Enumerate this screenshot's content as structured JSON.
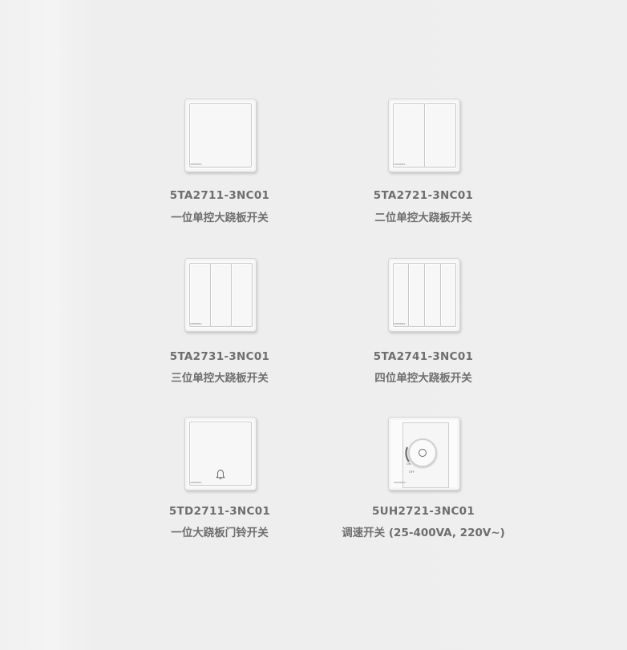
{
  "products": [
    {
      "code": "5TA2711-3NC01",
      "name": "一位单控大跷板开关",
      "brand": "SIEMENS"
    },
    {
      "code": "5TA2721-3NC01",
      "name": "二位单控大跷板开关",
      "brand": "SIEMENS"
    },
    {
      "code": "5TA2731-3NC01",
      "name": "三位单控大跷板开关",
      "brand": "SIEMENS"
    },
    {
      "code": "5TA2741-3NC01",
      "name": "四位单控大跷板开关",
      "brand": "SIEMENS"
    },
    {
      "code": "5TD2711-3NC01",
      "name": "一位大跷板门铃开关",
      "brand": "SIEMENS",
      "icon": "bell-icon"
    },
    {
      "code": "5UH2721-3NC01",
      "name": "调速开关 (25-400VA, 220V~)",
      "brand": "SIEMENS",
      "dimmer_on": "ON",
      "dimmer_off": "OFF"
    }
  ]
}
